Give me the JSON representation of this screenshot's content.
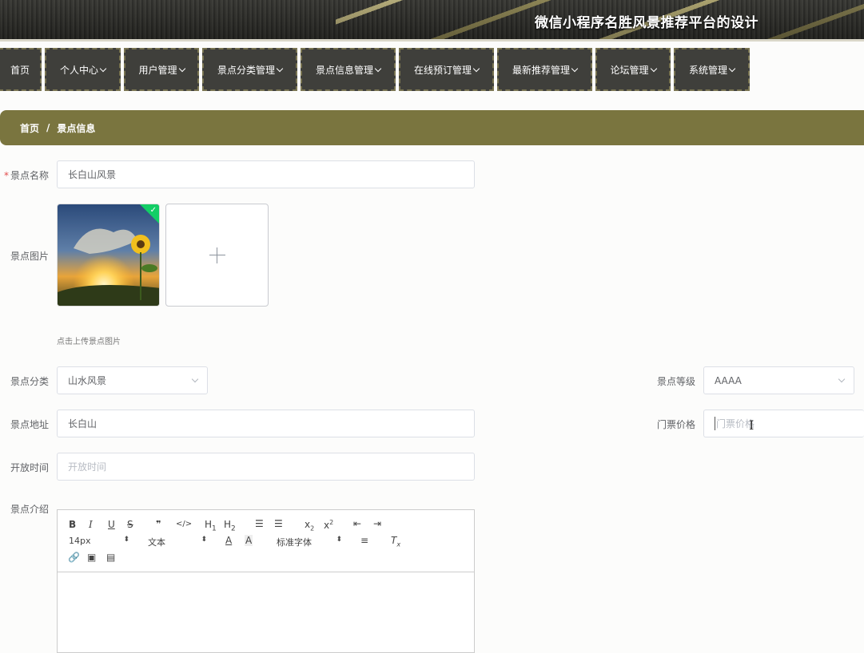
{
  "app": {
    "title": "微信小程序名胜风景推荐平台的设计"
  },
  "nav": {
    "items": [
      {
        "label": "首页",
        "has_menu": false
      },
      {
        "label": "个人中心",
        "has_menu": true
      },
      {
        "label": "用户管理",
        "has_menu": true
      },
      {
        "label": "景点分类管理",
        "has_menu": true
      },
      {
        "label": "景点信息管理",
        "has_menu": true
      },
      {
        "label": "在线预订管理",
        "has_menu": true
      },
      {
        "label": "最新推荐管理",
        "has_menu": true
      },
      {
        "label": "论坛管理",
        "has_menu": true
      },
      {
        "label": "系统管理",
        "has_menu": true
      }
    ]
  },
  "breadcrumb": {
    "home": "首页",
    "separator": "/",
    "current": "景点信息"
  },
  "form": {
    "name": {
      "label": "景点名称",
      "required_mark": "*",
      "value": "长白山风景"
    },
    "image": {
      "label": "景点图片",
      "hint": "点击上传景点图片",
      "upload_icon": "plus-icon",
      "uploaded_status": "success"
    },
    "category": {
      "label": "景点分类",
      "value": "山水风景"
    },
    "level": {
      "label": "景点等级",
      "value": "AAAA"
    },
    "address": {
      "label": "景点地址",
      "value": "长白山"
    },
    "price": {
      "label": "门票价格",
      "placeholder": "门票价格"
    },
    "open_time": {
      "label": "开放时间",
      "placeholder": "开放时间"
    },
    "intro": {
      "label": "景点介绍"
    }
  },
  "editor": {
    "row1": [
      "B",
      "I",
      "U",
      "S",
      "99",
      "</>",
      "H1",
      "H2",
      "ol",
      "ul",
      "x2-sub",
      "x2-sup",
      "outdent",
      "indent"
    ],
    "font_size": "14px",
    "header_type": "文本",
    "font_family": "标准字体",
    "row3": [
      "link",
      "image",
      "video"
    ]
  },
  "colors": {
    "accent": "#7a753f",
    "nav_bg": "#3f3f3b",
    "success": "#13ce66"
  }
}
